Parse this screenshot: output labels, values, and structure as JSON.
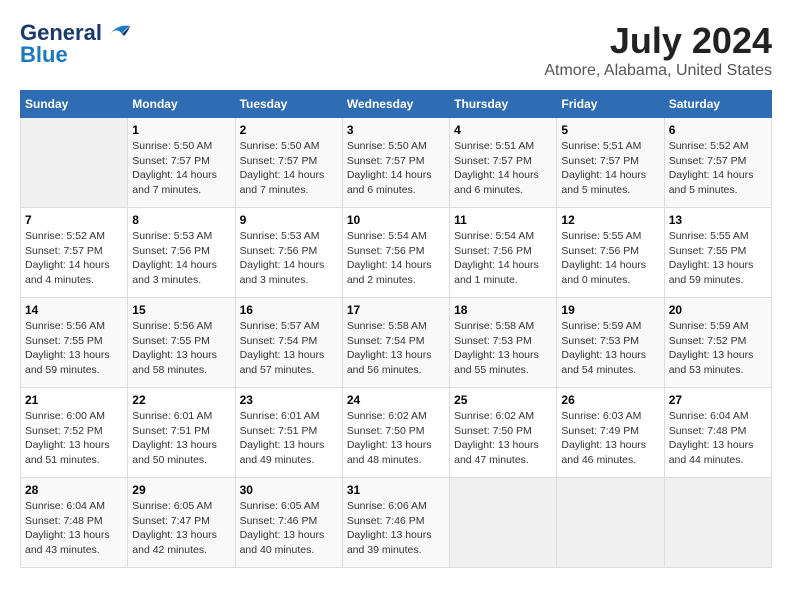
{
  "header": {
    "logo_general": "General",
    "logo_blue": "Blue",
    "month_year": "July 2024",
    "location": "Atmore, Alabama, United States"
  },
  "days_of_week": [
    "Sunday",
    "Monday",
    "Tuesday",
    "Wednesday",
    "Thursday",
    "Friday",
    "Saturday"
  ],
  "weeks": [
    [
      {
        "date": "",
        "content": ""
      },
      {
        "date": "1",
        "content": "Sunrise: 5:50 AM\nSunset: 7:57 PM\nDaylight: 14 hours\nand 7 minutes."
      },
      {
        "date": "2",
        "content": "Sunrise: 5:50 AM\nSunset: 7:57 PM\nDaylight: 14 hours\nand 7 minutes."
      },
      {
        "date": "3",
        "content": "Sunrise: 5:50 AM\nSunset: 7:57 PM\nDaylight: 14 hours\nand 6 minutes."
      },
      {
        "date": "4",
        "content": "Sunrise: 5:51 AM\nSunset: 7:57 PM\nDaylight: 14 hours\nand 6 minutes."
      },
      {
        "date": "5",
        "content": "Sunrise: 5:51 AM\nSunset: 7:57 PM\nDaylight: 14 hours\nand 5 minutes."
      },
      {
        "date": "6",
        "content": "Sunrise: 5:52 AM\nSunset: 7:57 PM\nDaylight: 14 hours\nand 5 minutes."
      }
    ],
    [
      {
        "date": "7",
        "content": "Sunrise: 5:52 AM\nSunset: 7:57 PM\nDaylight: 14 hours\nand 4 minutes."
      },
      {
        "date": "8",
        "content": "Sunrise: 5:53 AM\nSunset: 7:56 PM\nDaylight: 14 hours\nand 3 minutes."
      },
      {
        "date": "9",
        "content": "Sunrise: 5:53 AM\nSunset: 7:56 PM\nDaylight: 14 hours\nand 3 minutes."
      },
      {
        "date": "10",
        "content": "Sunrise: 5:54 AM\nSunset: 7:56 PM\nDaylight: 14 hours\nand 2 minutes."
      },
      {
        "date": "11",
        "content": "Sunrise: 5:54 AM\nSunset: 7:56 PM\nDaylight: 14 hours\nand 1 minute."
      },
      {
        "date": "12",
        "content": "Sunrise: 5:55 AM\nSunset: 7:56 PM\nDaylight: 14 hours\nand 0 minutes."
      },
      {
        "date": "13",
        "content": "Sunrise: 5:55 AM\nSunset: 7:55 PM\nDaylight: 13 hours\nand 59 minutes."
      }
    ],
    [
      {
        "date": "14",
        "content": "Sunrise: 5:56 AM\nSunset: 7:55 PM\nDaylight: 13 hours\nand 59 minutes."
      },
      {
        "date": "15",
        "content": "Sunrise: 5:56 AM\nSunset: 7:55 PM\nDaylight: 13 hours\nand 58 minutes."
      },
      {
        "date": "16",
        "content": "Sunrise: 5:57 AM\nSunset: 7:54 PM\nDaylight: 13 hours\nand 57 minutes."
      },
      {
        "date": "17",
        "content": "Sunrise: 5:58 AM\nSunset: 7:54 PM\nDaylight: 13 hours\nand 56 minutes."
      },
      {
        "date": "18",
        "content": "Sunrise: 5:58 AM\nSunset: 7:53 PM\nDaylight: 13 hours\nand 55 minutes."
      },
      {
        "date": "19",
        "content": "Sunrise: 5:59 AM\nSunset: 7:53 PM\nDaylight: 13 hours\nand 54 minutes."
      },
      {
        "date": "20",
        "content": "Sunrise: 5:59 AM\nSunset: 7:52 PM\nDaylight: 13 hours\nand 53 minutes."
      }
    ],
    [
      {
        "date": "21",
        "content": "Sunrise: 6:00 AM\nSunset: 7:52 PM\nDaylight: 13 hours\nand 51 minutes."
      },
      {
        "date": "22",
        "content": "Sunrise: 6:01 AM\nSunset: 7:51 PM\nDaylight: 13 hours\nand 50 minutes."
      },
      {
        "date": "23",
        "content": "Sunrise: 6:01 AM\nSunset: 7:51 PM\nDaylight: 13 hours\nand 49 minutes."
      },
      {
        "date": "24",
        "content": "Sunrise: 6:02 AM\nSunset: 7:50 PM\nDaylight: 13 hours\nand 48 minutes."
      },
      {
        "date": "25",
        "content": "Sunrise: 6:02 AM\nSunset: 7:50 PM\nDaylight: 13 hours\nand 47 minutes."
      },
      {
        "date": "26",
        "content": "Sunrise: 6:03 AM\nSunset: 7:49 PM\nDaylight: 13 hours\nand 46 minutes."
      },
      {
        "date": "27",
        "content": "Sunrise: 6:04 AM\nSunset: 7:48 PM\nDaylight: 13 hours\nand 44 minutes."
      }
    ],
    [
      {
        "date": "28",
        "content": "Sunrise: 6:04 AM\nSunset: 7:48 PM\nDaylight: 13 hours\nand 43 minutes."
      },
      {
        "date": "29",
        "content": "Sunrise: 6:05 AM\nSunset: 7:47 PM\nDaylight: 13 hours\nand 42 minutes."
      },
      {
        "date": "30",
        "content": "Sunrise: 6:05 AM\nSunset: 7:46 PM\nDaylight: 13 hours\nand 40 minutes."
      },
      {
        "date": "31",
        "content": "Sunrise: 6:06 AM\nSunset: 7:46 PM\nDaylight: 13 hours\nand 39 minutes."
      },
      {
        "date": "",
        "content": ""
      },
      {
        "date": "",
        "content": ""
      },
      {
        "date": "",
        "content": ""
      }
    ]
  ]
}
